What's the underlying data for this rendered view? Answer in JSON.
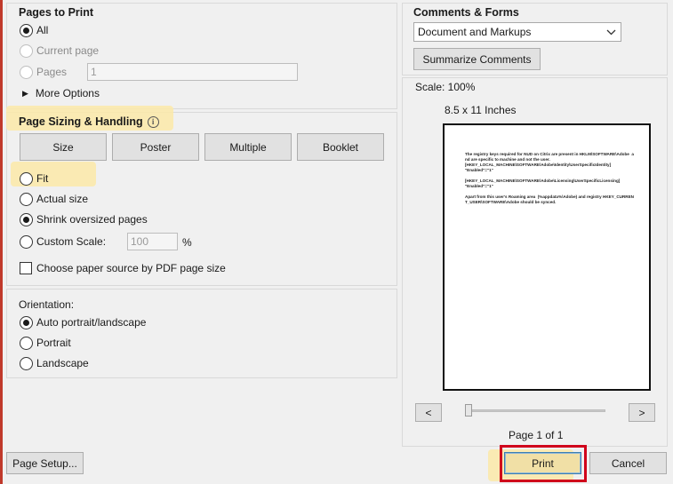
{
  "pages_to_print": {
    "title": "Pages to Print",
    "all_label": "All",
    "current_page_label": "Current page",
    "pages_label": "Pages",
    "pages_value": "1",
    "more_options_label": "More Options"
  },
  "page_sizing": {
    "title": "Page Sizing & Handling",
    "info_glyph": "i",
    "tabs": [
      {
        "label": "Size"
      },
      {
        "label": "Poster"
      },
      {
        "label": "Multiple"
      },
      {
        "label": "Booklet"
      }
    ],
    "fit_label": "Fit",
    "actual_size_label": "Actual size",
    "shrink_label": "Shrink oversized pages",
    "custom_scale_label": "Custom Scale:",
    "custom_scale_value": "100",
    "percent_sign": "%",
    "paper_source_label": "Choose paper source by PDF page size"
  },
  "orientation": {
    "title": "Orientation:",
    "auto_label": "Auto portrait/landscape",
    "portrait_label": "Portrait",
    "landscape_label": "Landscape"
  },
  "comments_forms": {
    "title": "Comments & Forms",
    "selected": "Document and Markups",
    "summarize_label": "Summarize Comments"
  },
  "preview": {
    "scale_text": "Scale: 100%",
    "paper_size": "8.5 x 11 Inches",
    "page_text": "The registry keys required for NUD on Citrix are present in HKLM\\SOFTWARE\\Adobe  and are specific to machine and not the user.\n[HKEY_LOCAL_MACHINE\\SOFTWARE\\Adobe\\Identity\\UserSpecificIdentity]\n\"Enabled\"=\"1\"\n\n[HKEY_LOCAL_MACHINE\\SOFTWARE\\Adobe\\Licensing\\UserSpecificLicensing]\n\"Enabled\"=\"1\"\n\nApart from this user's Roaming area  (%appdata%\\Adobe) and registry HKEY_CURRENT_USER\\SOFTWARE\\Adobe should be synced.",
    "prev_label": "<",
    "next_label": ">",
    "page_indicator": "Page 1 of 1"
  },
  "footer": {
    "page_setup_label": "Page Setup...",
    "print_label": "Print",
    "cancel_label": "Cancel"
  },
  "colors": {
    "highlight": "#fbe9a8",
    "print_outline": "#d0021b"
  }
}
